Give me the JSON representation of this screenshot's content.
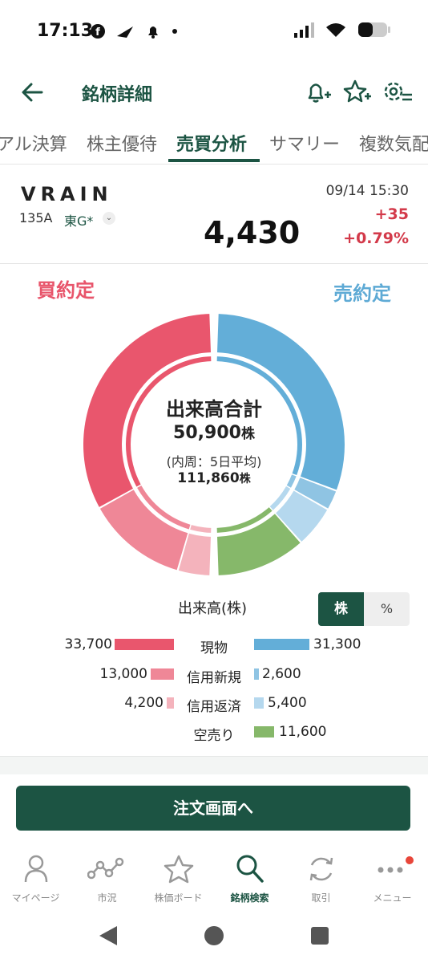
{
  "status": {
    "time": "17:13"
  },
  "header": {
    "title": "銘柄詳細"
  },
  "tabs": [
    "アル決算",
    "株主優待",
    "売買分析",
    "サマリー",
    "複数気配"
  ],
  "stock": {
    "name": "VRAIN",
    "code": "135A",
    "market": "東G*",
    "price": "4,430",
    "datetime": "09/14 15:30",
    "change": "+35",
    "change_pct": "+0.79%"
  },
  "analysis": {
    "buy_label": "買約定",
    "sell_label": "売約定",
    "center_title": "出来高合計",
    "total_volume": "50,900",
    "unit": "株",
    "inner_note": "(内周：5日平均)",
    "avg_volume": "111,860",
    "volume_label": "出来高(株)",
    "toggle_shares": "株",
    "toggle_pct": "%"
  },
  "chart_data": {
    "type": "donut",
    "unit": "株",
    "buy": [
      {
        "label": "現物",
        "value": 33700
      },
      {
        "label": "信用新規",
        "value": 13000
      },
      {
        "label": "信用返済",
        "value": 4200
      }
    ],
    "sell": [
      {
        "label": "現物",
        "value": 31300
      },
      {
        "label": "信用新規",
        "value": 2600
      },
      {
        "label": "信用返済",
        "value": 5400
      },
      {
        "label": "空売り",
        "value": 11600
      }
    ],
    "colors": {
      "buy": [
        "#e9566d",
        "#ef8797",
        "#f4b3bc"
      ],
      "sell": [
        "#63aed8",
        "#8fc4e3",
        "#b5d8ee",
        "#86b86a"
      ]
    }
  },
  "legend": [
    {
      "label": "現物",
      "buy": "33,700",
      "sell": "31,300"
    },
    {
      "label": "信用新規",
      "buy": "13,000",
      "sell": "2,600"
    },
    {
      "label": "信用返済",
      "buy": "4,200",
      "sell": "5,400"
    },
    {
      "label": "空売り",
      "buy": "",
      "sell": "11,600"
    }
  ],
  "order_button": "注文画面へ",
  "nav": [
    "マイページ",
    "市況",
    "株価ボード",
    "銘柄検索",
    "取引",
    "メニュー"
  ]
}
